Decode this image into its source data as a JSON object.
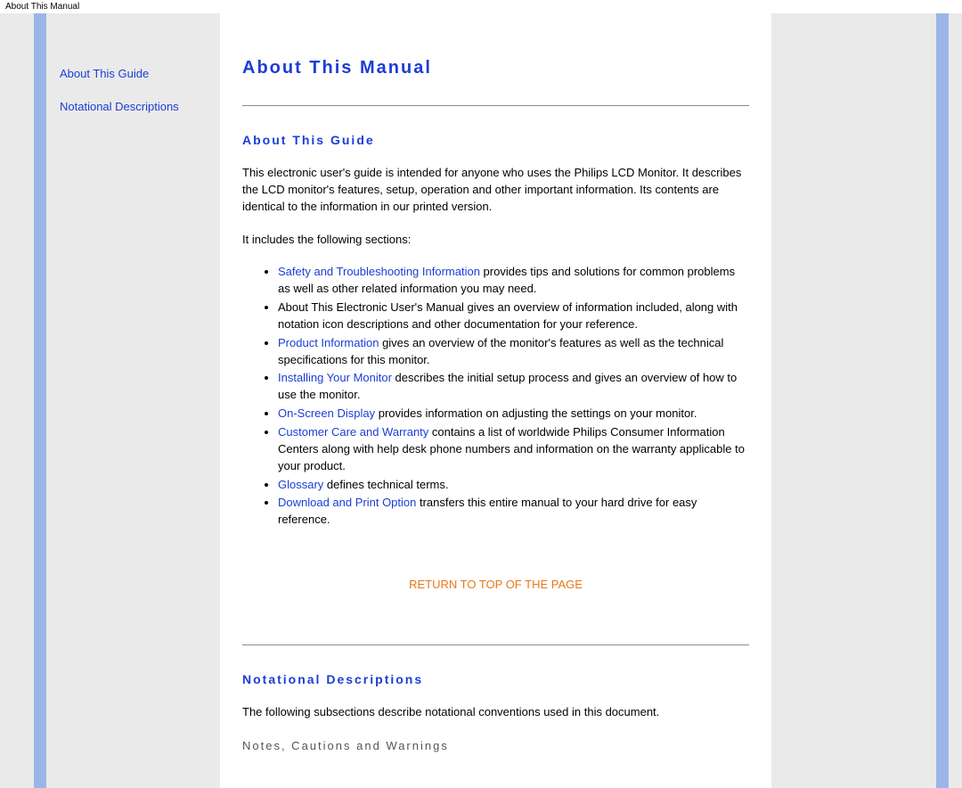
{
  "header_bar": "About This Manual",
  "sidebar": {
    "links": [
      {
        "label": "About This Guide"
      },
      {
        "label": "Notational Descriptions"
      }
    ]
  },
  "main": {
    "title": "About This Manual",
    "section1": {
      "heading": "About This Guide",
      "intro": "This electronic user's guide is intended for anyone who uses the Philips LCD Monitor. It describes the LCD monitor's features, setup, operation and other important information. Its contents are identical to the information in our printed version.",
      "lead_in": "It includes the following sections:",
      "items": [
        {
          "link": "Safety and Troubleshooting Information",
          "rest": " provides tips and solutions for common problems as well as other related information you may need."
        },
        {
          "link": "",
          "rest": "About This Electronic User's Manual gives an overview of information included, along with notation icon descriptions and other documentation for your reference."
        },
        {
          "link": "Product Information",
          "rest": " gives an overview of the monitor's features as well as the technical specifications for this monitor."
        },
        {
          "link": "Installing Your Monitor",
          "rest": " describes the initial setup process and gives an overview of how to use the monitor."
        },
        {
          "link": "On-Screen Display",
          "rest": " provides information on adjusting the settings on your monitor."
        },
        {
          "link": "Customer Care and Warranty",
          "rest": " contains a list of worldwide Philips Consumer Information Centers along with help desk phone numbers and information on the warranty applicable to your product."
        },
        {
          "link": "Glossary",
          "rest": " defines technical terms."
        },
        {
          "link": "Download and Print Option",
          "rest": " transfers this entire manual to your hard drive for easy reference."
        }
      ],
      "return_top": "RETURN TO TOP OF THE PAGE"
    },
    "section2": {
      "heading": "Notational Descriptions",
      "intro": "The following subsections describe notational conventions used in this document.",
      "subheading": "Notes, Cautions and Warnings"
    }
  }
}
